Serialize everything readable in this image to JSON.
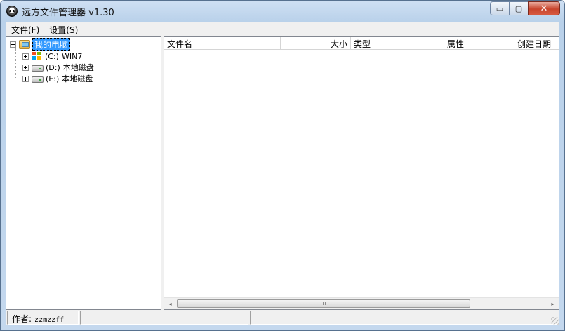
{
  "window": {
    "title": "远方文件管理器 v1.30",
    "icon": "skull-icon",
    "caption": {
      "minimize": "▭",
      "maximize": "▢",
      "close": "✕"
    }
  },
  "menu": [
    {
      "label": "文件(F)"
    },
    {
      "label": "设置(S)"
    }
  ],
  "tree": {
    "root": {
      "label": "我的电脑",
      "icon": "computer-folder-icon",
      "selected": true
    },
    "drives": [
      {
        "letter": "(C:)",
        "name": "WIN7",
        "icon": "windows-drive-icon"
      },
      {
        "letter": "(D:)",
        "name": "本地磁盘",
        "icon": "hard-drive-icon"
      },
      {
        "letter": "(E:)",
        "name": "本地磁盘",
        "icon": "hard-drive-icon"
      }
    ]
  },
  "list": {
    "columns": [
      "文件名",
      "大小",
      "类型",
      "属性",
      "创建日期"
    ],
    "rows": []
  },
  "scrollbar": {
    "left_arrow": "◂",
    "right_arrow": "▸",
    "thumb_grip": "III"
  },
  "status": {
    "author_label": "作者:",
    "author_value": "zzmzzff",
    "panel2": "",
    "panel3": ""
  }
}
